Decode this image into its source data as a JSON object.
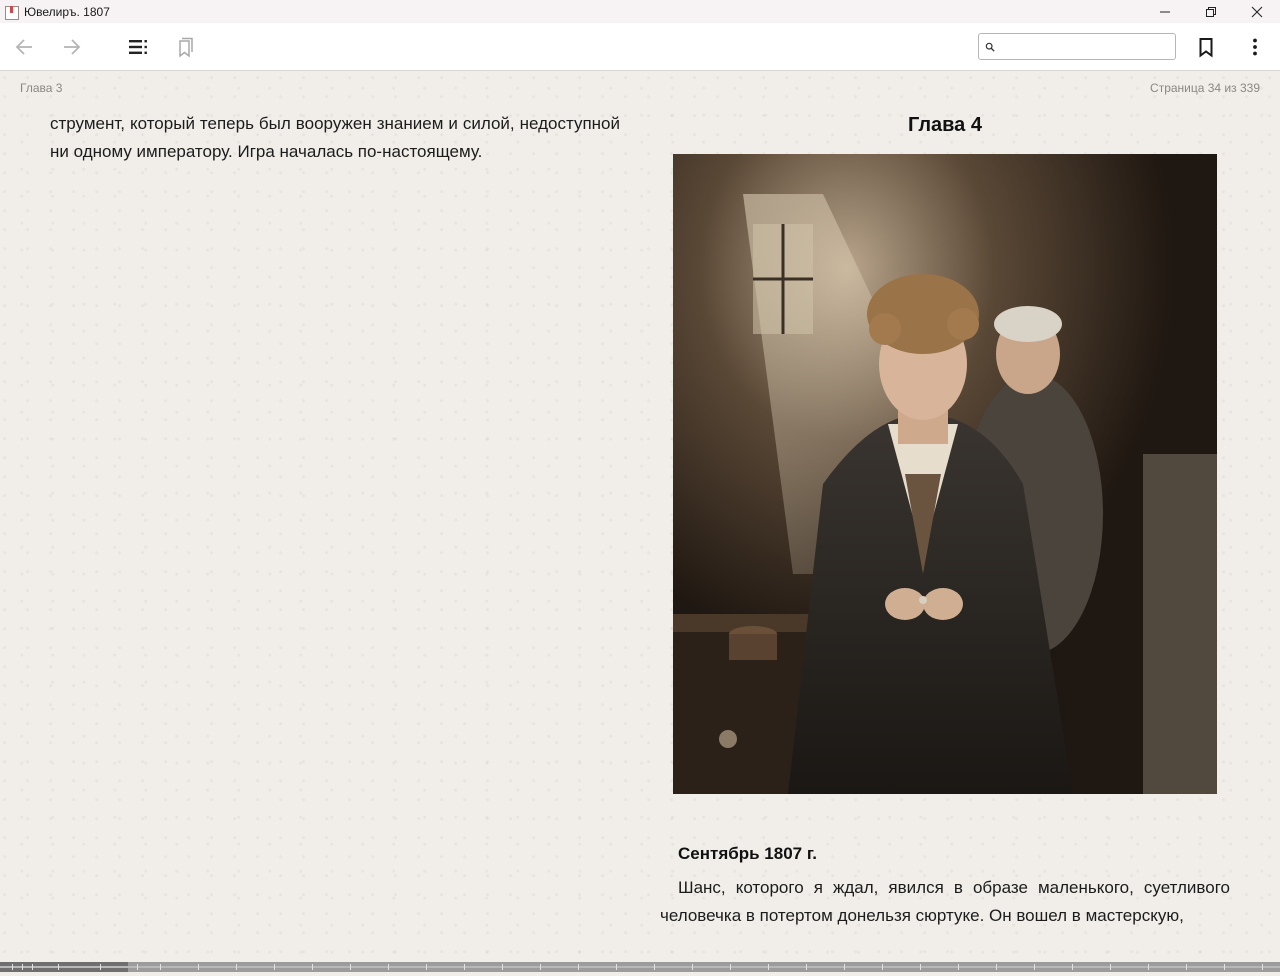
{
  "window": {
    "title": "Ювелиръ. 1807"
  },
  "toolbar": {
    "search_placeholder": ""
  },
  "reader": {
    "header_left": "Глава 3",
    "header_right": "Страница 34 из 339",
    "left_column_text": "струмент, который теперь был вооружен знанием и силой, недо­ступной ни одному императору. Игра началась по-настоящему.",
    "chapter_title": "Глава 4",
    "date_heading": "Сентябрь 1807 г.",
    "paragraph": "Шанс, которого я ждал, явился в образе маленького, суетливого человечка в потертом донельзя сюртуке. Он вошел в мастерскую,"
  },
  "progress": {
    "current_page": 34,
    "total_pages": 339
  }
}
